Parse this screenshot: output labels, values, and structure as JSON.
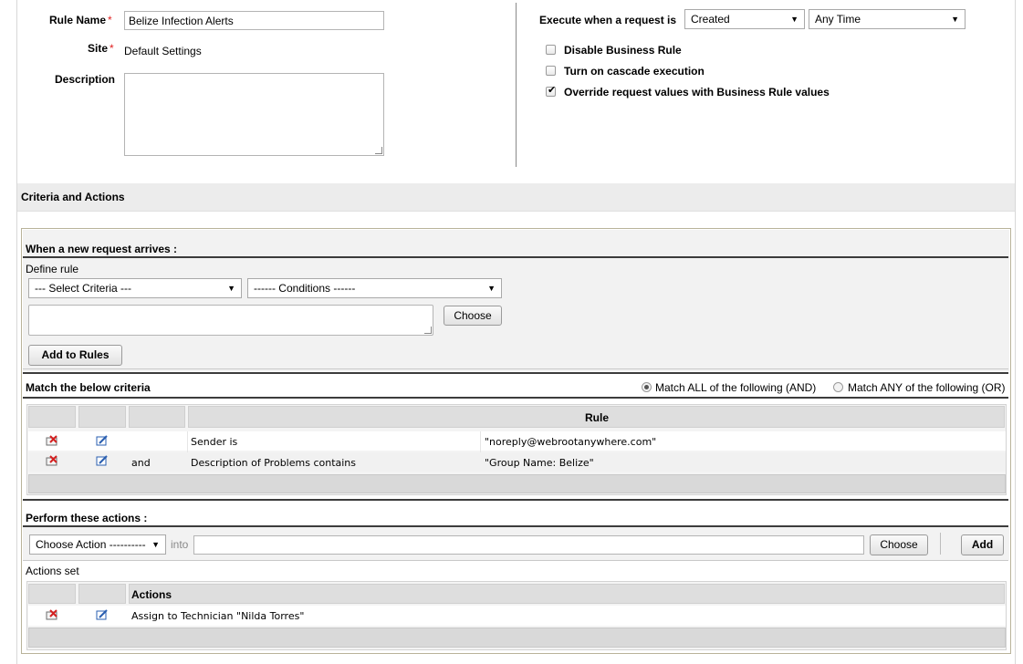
{
  "form": {
    "rule_name_label": "Rule Name",
    "rule_name_value": "Belize Infection Alerts",
    "site_label": "Site",
    "site_value": "Default Settings",
    "description_label": "Description",
    "required_mark": "*"
  },
  "execute": {
    "label": "Execute when a request is",
    "event_value": "Created",
    "time_value": "Any Time",
    "options": [
      {
        "label": "Disable Business Rule",
        "checked": false
      },
      {
        "label": "Turn on cascade execution",
        "checked": false
      },
      {
        "label": "Override request values with Business Rule values",
        "checked": true
      }
    ]
  },
  "criteria_section": {
    "title": "Criteria and Actions",
    "when_label": "When a new request arrives :",
    "define_rule_label": "Define rule",
    "criteria_select": "--- Select Criteria ---",
    "conditions_select": "------ Conditions ------",
    "choose_label": "Choose",
    "add_to_rules_label": "Add to Rules",
    "match_label": "Match the below criteria",
    "match_all_label": "Match ALL of the following (AND)",
    "match_any_label": "Match ANY of the following (OR)",
    "rule_column_header": "Rule",
    "rules": [
      {
        "conjunction": "",
        "field": "Sender is",
        "value": "\"noreply@webrootanywhere.com\""
      },
      {
        "conjunction": "and",
        "field": "Description of Problems contains",
        "value": "\"Group Name: Belize\""
      }
    ]
  },
  "actions_section": {
    "title": "Perform these actions :",
    "choose_action_select": "Choose Action ----------",
    "into_label": "into",
    "choose_label": "Choose",
    "add_label": "Add",
    "actions_set_label": "Actions set",
    "actions_column_header": "Actions",
    "actions": [
      {
        "text": "Assign to Technician \"Nilda Torres\""
      }
    ]
  },
  "icons": {
    "delete": "delete-icon",
    "edit": "edit-icon",
    "dropdown": "chevron-down-icon"
  }
}
